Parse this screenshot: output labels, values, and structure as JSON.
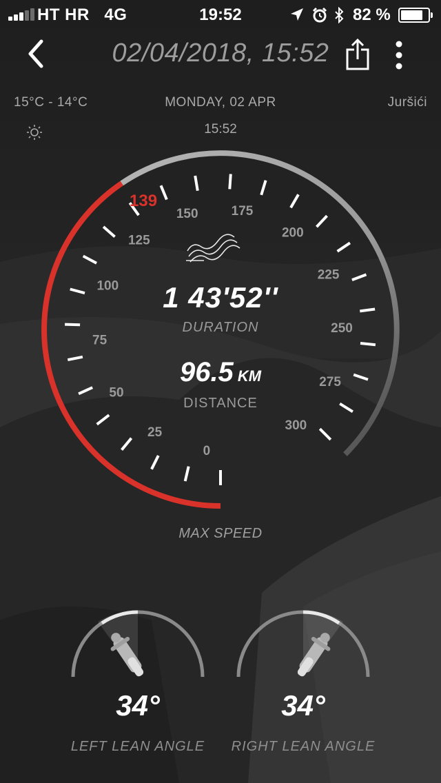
{
  "status_bar": {
    "carrier": "HT HR",
    "network": "4G",
    "time": "19:52",
    "battery_percent": "82 %",
    "battery_level": 0.82,
    "signal_bars": 3,
    "icons": [
      "location-arrow-icon",
      "alarm-icon",
      "bluetooth-icon"
    ]
  },
  "nav": {
    "title": "02/04/2018, 15:52",
    "back_icon": "chevron-left-icon",
    "share_icon": "share-icon",
    "more_icon": "more-vertical-icon"
  },
  "info": {
    "temperature": "15°C - 14°C",
    "date": "MONDAY, 02 APR",
    "location": "Juršići",
    "start_time": "15:52",
    "weather_icon": "sun-icon"
  },
  "gauge": {
    "min": 0,
    "max": 300,
    "tick_labels": [
      "0",
      "25",
      "50",
      "75",
      "100",
      "125",
      "150",
      "175",
      "200",
      "225",
      "250",
      "275",
      "300"
    ],
    "max_speed": "139",
    "max_speed_value": 139,
    "max_speed_label": "MAX SPEED",
    "route_icon": "route-waves-icon",
    "duration": "1 43'52''",
    "duration_label": "DURATION",
    "distance": "96.5",
    "distance_unit": "KM",
    "distance_label": "DISTANCE",
    "colors": {
      "accent": "#d9322a",
      "track": "#9a9a9a"
    }
  },
  "lean": {
    "left": {
      "value": "34°",
      "label": "LEFT LEAN ANGLE",
      "angle_deg": 34
    },
    "right": {
      "value": "34°",
      "label": "RIGHT LEAN ANGLE",
      "angle_deg": 34
    }
  }
}
